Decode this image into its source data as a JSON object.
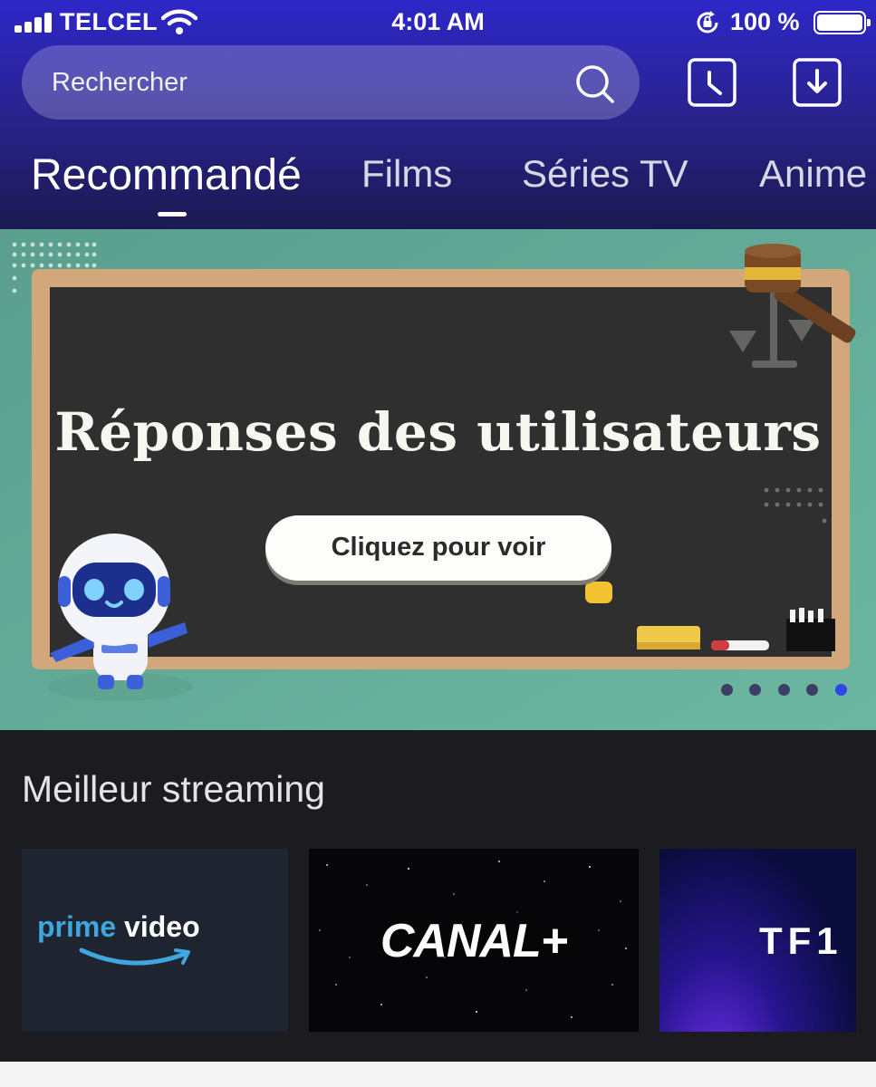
{
  "status_bar": {
    "carrier": "TELCEL",
    "time": "4:01 AM",
    "battery_percent": "100 %",
    "battery_level": 1.0
  },
  "search": {
    "placeholder": "Rechercher"
  },
  "tabs": [
    {
      "label": "Recommandé",
      "active": true
    },
    {
      "label": "Films",
      "active": false
    },
    {
      "label": "Séries TV",
      "active": false
    },
    {
      "label": "Anime",
      "active": false
    }
  ],
  "banner": {
    "title": "Réponses des utilisateurs",
    "cta_label": "Cliquez pour voir",
    "slide_count": 5,
    "active_slide": 5
  },
  "sections": {
    "streaming": {
      "title": "Meilleur streaming",
      "providers": [
        {
          "name_main": "prime",
          "name_secondary": "video"
        },
        {
          "name_main": "CANAL+"
        },
        {
          "name_main": "TF1"
        }
      ]
    }
  },
  "colors": {
    "header_top": "#2d27c8",
    "header_bottom": "#1c1a50",
    "background": "#1c1c20",
    "accent_dot": "#2e46e6",
    "prime_blue": "#3fa6de"
  },
  "icons": [
    "signal-icon",
    "wifi-icon",
    "rotation-lock-icon",
    "battery-icon",
    "search-icon",
    "history-icon",
    "download-icon"
  ]
}
